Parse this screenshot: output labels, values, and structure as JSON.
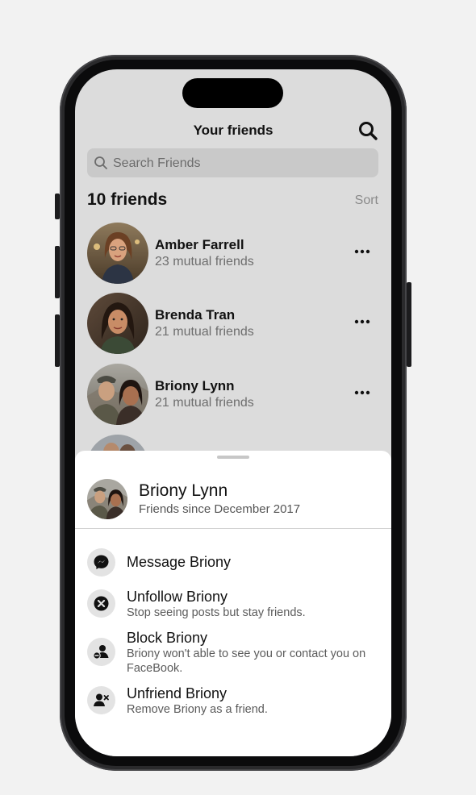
{
  "header": {
    "title": "Your friends",
    "search_icon": "search-icon"
  },
  "search": {
    "placeholder": "Search Friends"
  },
  "list": {
    "count_label": "10 friends",
    "sort_label": "Sort"
  },
  "friends": [
    {
      "name": "Amber Farrell",
      "mutual": "23 mutual friends"
    },
    {
      "name": "Brenda Tran",
      "mutual": "21 mutual friends"
    },
    {
      "name": "Briony Lynn",
      "mutual": "21 mutual friends"
    }
  ],
  "sheet": {
    "name": "Briony Lynn",
    "since": "Friends since December 2017",
    "actions": [
      {
        "title": "Message Briony",
        "desc": "",
        "icon": "messenger-icon"
      },
      {
        "title": "Unfollow Briony",
        "desc": "Stop seeing posts but stay friends.",
        "icon": "unfollow-icon"
      },
      {
        "title": "Block Briony",
        "desc": "Briony won't able to see you or contact you on FaceBook.",
        "icon": "block-user-icon"
      },
      {
        "title": "Unfriend Briony",
        "desc": "Remove Briony as a friend.",
        "icon": "unfriend-icon"
      }
    ]
  },
  "colors": {
    "screen_bg": "#dcdcdc",
    "sheet_bg": "#ffffff",
    "muted_text": "#6e6e6e"
  }
}
